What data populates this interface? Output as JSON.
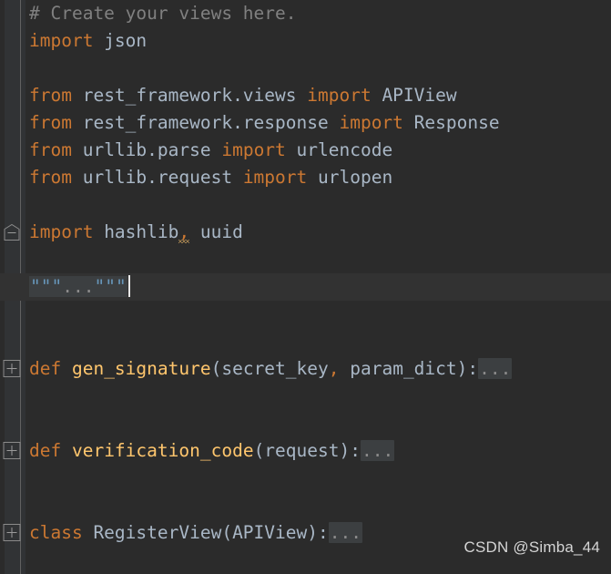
{
  "editor": {
    "theme_name": "darcula",
    "background": "#2b2b2b",
    "gutter_background": "#313335",
    "current_line_background": "#323232",
    "colors": {
      "comment": "#808080",
      "keyword": "#cc7832",
      "identifier": "#a9b7c6",
      "function_name": "#ffc66d",
      "quote": "#6897bb",
      "folded_placeholder": "#8c8c8c",
      "folded_chip_background": "#3c3f41",
      "warning_squiggle": "#bc9458",
      "caret": "#e8e8e8"
    }
  },
  "lines": [
    {
      "n": 1,
      "fold": "none",
      "tokens": [
        {
          "t": "cmt",
          "v": "# Create your views here."
        }
      ]
    },
    {
      "n": 2,
      "fold": "none",
      "tokens": [
        {
          "t": "kw",
          "v": "import"
        },
        {
          "t": "id",
          "v": " json"
        }
      ]
    },
    {
      "n": 3,
      "fold": "none",
      "tokens": []
    },
    {
      "n": 4,
      "fold": "none",
      "tokens": [
        {
          "t": "kw",
          "v": "from"
        },
        {
          "t": "id",
          "v": " rest_framework.views "
        },
        {
          "t": "kw",
          "v": "import"
        },
        {
          "t": "id",
          "v": " APIView"
        }
      ]
    },
    {
      "n": 5,
      "fold": "none",
      "tokens": [
        {
          "t": "kw",
          "v": "from"
        },
        {
          "t": "id",
          "v": " rest_framework.response "
        },
        {
          "t": "kw",
          "v": "import"
        },
        {
          "t": "id",
          "v": " Response"
        }
      ]
    },
    {
      "n": 6,
      "fold": "none",
      "tokens": [
        {
          "t": "kw",
          "v": "from"
        },
        {
          "t": "id",
          "v": " urllib.parse "
        },
        {
          "t": "kw",
          "v": "import"
        },
        {
          "t": "id",
          "v": " urlencode"
        }
      ]
    },
    {
      "n": 7,
      "fold": "none",
      "tokens": [
        {
          "t": "kw",
          "v": "from"
        },
        {
          "t": "id",
          "v": " urllib.request "
        },
        {
          "t": "kw",
          "v": "import"
        },
        {
          "t": "id",
          "v": " urlopen"
        }
      ]
    },
    {
      "n": 8,
      "fold": "none",
      "tokens": []
    },
    {
      "n": 9,
      "fold": "expanded",
      "tokens": [
        {
          "t": "kw",
          "v": "import"
        },
        {
          "t": "id",
          "v": " hashlib"
        },
        {
          "t": "warn",
          "v": ","
        },
        {
          "t": "id",
          "v": " uuid"
        }
      ]
    },
    {
      "n": 10,
      "fold": "none",
      "tokens": []
    },
    {
      "n": 11,
      "fold": "collapsed",
      "current": true,
      "tokens": [
        {
          "t": "folddoc",
          "v": "\"\"\"...\"\"\""
        },
        {
          "t": "caret",
          "v": ""
        }
      ]
    },
    {
      "n": 12,
      "fold": "none",
      "tokens": []
    },
    {
      "n": 13,
      "fold": "none",
      "tokens": []
    },
    {
      "n": 14,
      "fold": "collapsed",
      "tokens": [
        {
          "t": "kw",
          "v": "def"
        },
        {
          "t": "fn",
          "v": " gen_signature"
        },
        {
          "t": "pn",
          "v": "(secret_key"
        },
        {
          "t": "kw",
          "v": ","
        },
        {
          "t": "pn",
          "v": " param_dict):"
        },
        {
          "t": "foldchip",
          "v": "..."
        }
      ]
    },
    {
      "n": 15,
      "fold": "none",
      "tokens": []
    },
    {
      "n": 16,
      "fold": "none",
      "tokens": []
    },
    {
      "n": 17,
      "fold": "collapsed",
      "tokens": [
        {
          "t": "kw",
          "v": "def"
        },
        {
          "t": "fn",
          "v": " verification_code"
        },
        {
          "t": "pn",
          "v": "(request):"
        },
        {
          "t": "foldchip",
          "v": "..."
        }
      ]
    },
    {
      "n": 18,
      "fold": "none",
      "tokens": []
    },
    {
      "n": 19,
      "fold": "none",
      "tokens": []
    },
    {
      "n": 20,
      "fold": "collapsed",
      "tokens": [
        {
          "t": "kw",
          "v": "class"
        },
        {
          "t": "id",
          "v": " RegisterView"
        },
        {
          "t": "pn",
          "v": "(APIView):"
        },
        {
          "t": "foldchip",
          "v": "..."
        }
      ]
    },
    {
      "n": 21,
      "fold": "none",
      "tokens": []
    }
  ],
  "watermark": {
    "text": "CSDN @Simba_44"
  }
}
